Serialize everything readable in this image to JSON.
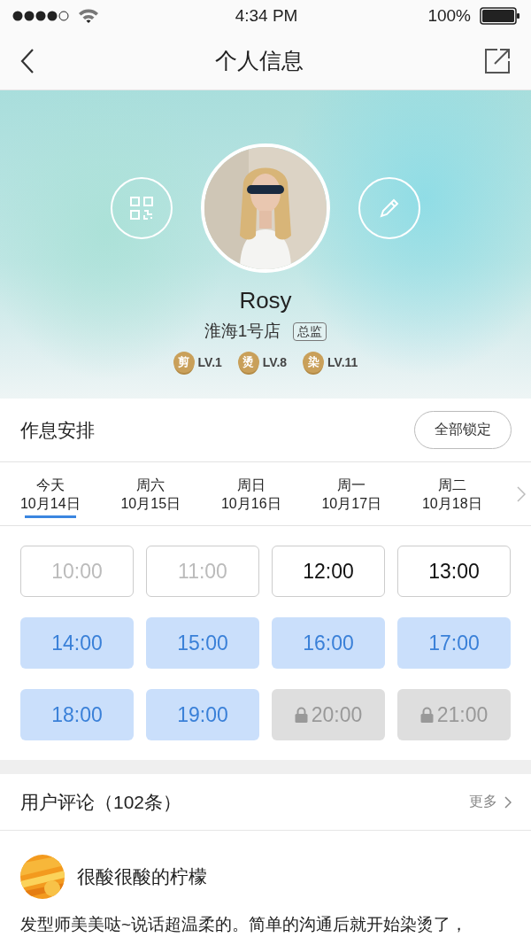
{
  "status_bar": {
    "time": "4:34 PM",
    "battery": "100%"
  },
  "nav": {
    "title": "个人信息"
  },
  "profile": {
    "name": "Rosy",
    "store": "淮海1号店",
    "role": "总监",
    "skills": [
      {
        "badge": "剪",
        "level": "LV.1"
      },
      {
        "badge": "烫",
        "level": "LV.8"
      },
      {
        "badge": "染",
        "level": "LV.11"
      }
    ]
  },
  "schedule": {
    "title": "作息安排",
    "lock_all": "全部锁定",
    "days": [
      {
        "weekday": "今天",
        "date": "10月14日",
        "selected": true
      },
      {
        "weekday": "周六",
        "date": "10月15日",
        "selected": false
      },
      {
        "weekday": "周日",
        "date": "10月16日",
        "selected": false
      },
      {
        "weekday": "周一",
        "date": "10月17日",
        "selected": false
      },
      {
        "weekday": "周二",
        "date": "10月18日",
        "selected": false
      }
    ],
    "slots": [
      {
        "time": "10:00",
        "kind": "past"
      },
      {
        "time": "11:00",
        "kind": "past"
      },
      {
        "time": "12:00",
        "kind": "free"
      },
      {
        "time": "13:00",
        "kind": "free"
      },
      {
        "time": "14:00",
        "kind": "booked"
      },
      {
        "time": "15:00",
        "kind": "booked"
      },
      {
        "time": "16:00",
        "kind": "booked"
      },
      {
        "time": "17:00",
        "kind": "booked"
      },
      {
        "time": "18:00",
        "kind": "booked"
      },
      {
        "time": "19:00",
        "kind": "booked"
      },
      {
        "time": "20:00",
        "kind": "locked"
      },
      {
        "time": "21:00",
        "kind": "locked"
      }
    ]
  },
  "reviews": {
    "title": "用户评论（102条）",
    "more": "更多",
    "items": [
      {
        "user": "很酸很酸的柠檬",
        "text": "发型师美美哒~说话超温柔的。简单的沟通后就开始染烫了，"
      }
    ]
  }
}
